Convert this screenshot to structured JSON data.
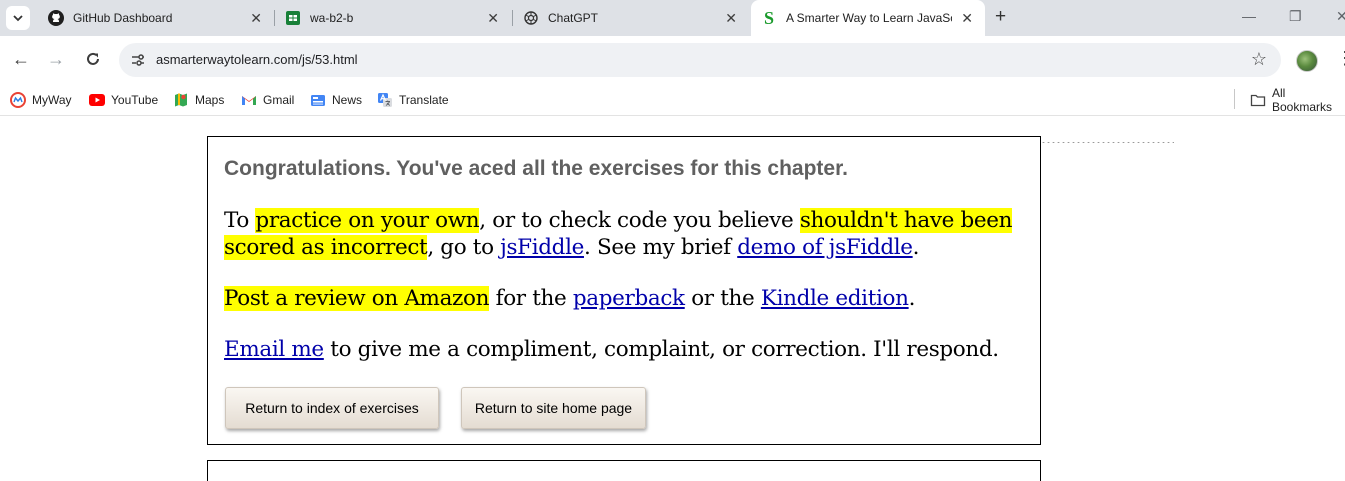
{
  "browser": {
    "tabs": [
      {
        "title": "GitHub Dashboard",
        "icon": "github-icon"
      },
      {
        "title": "wa-b2-b",
        "icon": "sheets-icon"
      },
      {
        "title": "ChatGPT",
        "icon": "chatgpt-icon"
      },
      {
        "title": "A Smarter Way to Learn JavaScr",
        "icon": "site-s-icon",
        "active": true
      }
    ],
    "url": "asmarterwaytolearn.com/js/53.html",
    "bookmarks": [
      "MyWay",
      "YouTube",
      "Maps",
      "Gmail",
      "News",
      "Translate"
    ],
    "all_bookmarks": "All Bookmarks"
  },
  "page": {
    "heading": "Congratulations. You've aced all the exercises for this chapter.",
    "p1": {
      "t1": "To ",
      "h1": "practice on your own",
      "t2": ", or to check code you believe ",
      "h2a": "shouldn't have been",
      "h2b": "scored as incorrect",
      "t3": ", go to ",
      "l1": "jsFiddle",
      "t4": ". See my brief ",
      "l2": "demo of jsFiddle",
      "t5": "."
    },
    "p2": {
      "h1": "Post a review on Amazon",
      "t1": " for the ",
      "l1": "paperback",
      "t2": " or the ",
      "l2": "Kindle edition",
      "t3": "."
    },
    "p3": {
      "l1": "Email me",
      "t1": " to give me a compliment, complaint, or correction. I'll respond."
    },
    "buttons": {
      "index": "Return to index of exercises",
      "home": "Return to site home page"
    }
  },
  "colors": {
    "highlight": "#ffff00",
    "link": "#0000aa",
    "heading": "#606060"
  }
}
